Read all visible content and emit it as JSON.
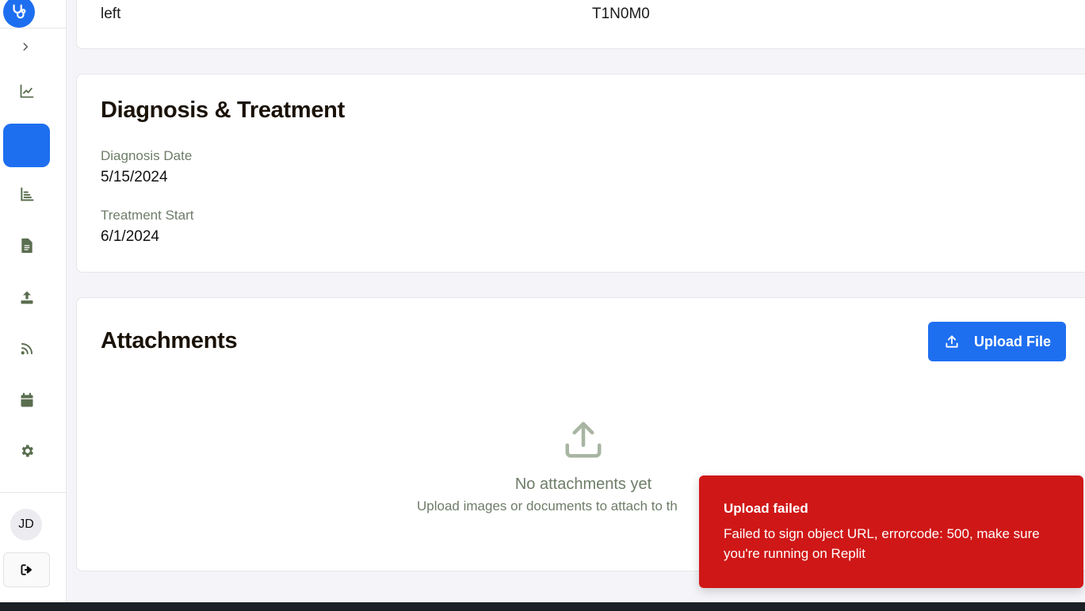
{
  "sidebar": {
    "nav": [
      {
        "name": "analytics",
        "icon": "line-chart-icon",
        "active": false
      },
      {
        "name": "current",
        "icon": "",
        "active": true
      },
      {
        "name": "reports",
        "icon": "bar-chart-icon",
        "active": false
      },
      {
        "name": "documents",
        "icon": "document-icon",
        "active": false
      },
      {
        "name": "upload",
        "icon": "upload-icon",
        "active": false
      },
      {
        "name": "feed",
        "icon": "rss-icon",
        "active": false
      },
      {
        "name": "calendar",
        "icon": "calendar-icon",
        "active": false
      },
      {
        "name": "settings",
        "icon": "gear-icon",
        "active": false
      }
    ],
    "user_initials": "JD"
  },
  "top_card": {
    "left_text": "left",
    "right_text": "T1N0M0"
  },
  "diagnosis": {
    "title": "Diagnosis & Treatment",
    "diagnosis_date_label": "Diagnosis Date",
    "diagnosis_date_value": "5/15/2024",
    "treatment_start_label": "Treatment Start",
    "treatment_start_value": "6/1/2024"
  },
  "attachments": {
    "title": "Attachments",
    "upload_button_label": "Upload File",
    "empty_title": "No attachments yet",
    "empty_subtitle": "Upload images or documents to attach to th"
  },
  "toast": {
    "title": "Upload failed",
    "message": "Failed to sign object URL, errorcode: 500, make sure you're running on Replit"
  },
  "colors": {
    "accent": "#1e6ff0",
    "error": "#d01717",
    "muted_text": "#6e7d68",
    "icon_green": "#5a6e4f"
  }
}
